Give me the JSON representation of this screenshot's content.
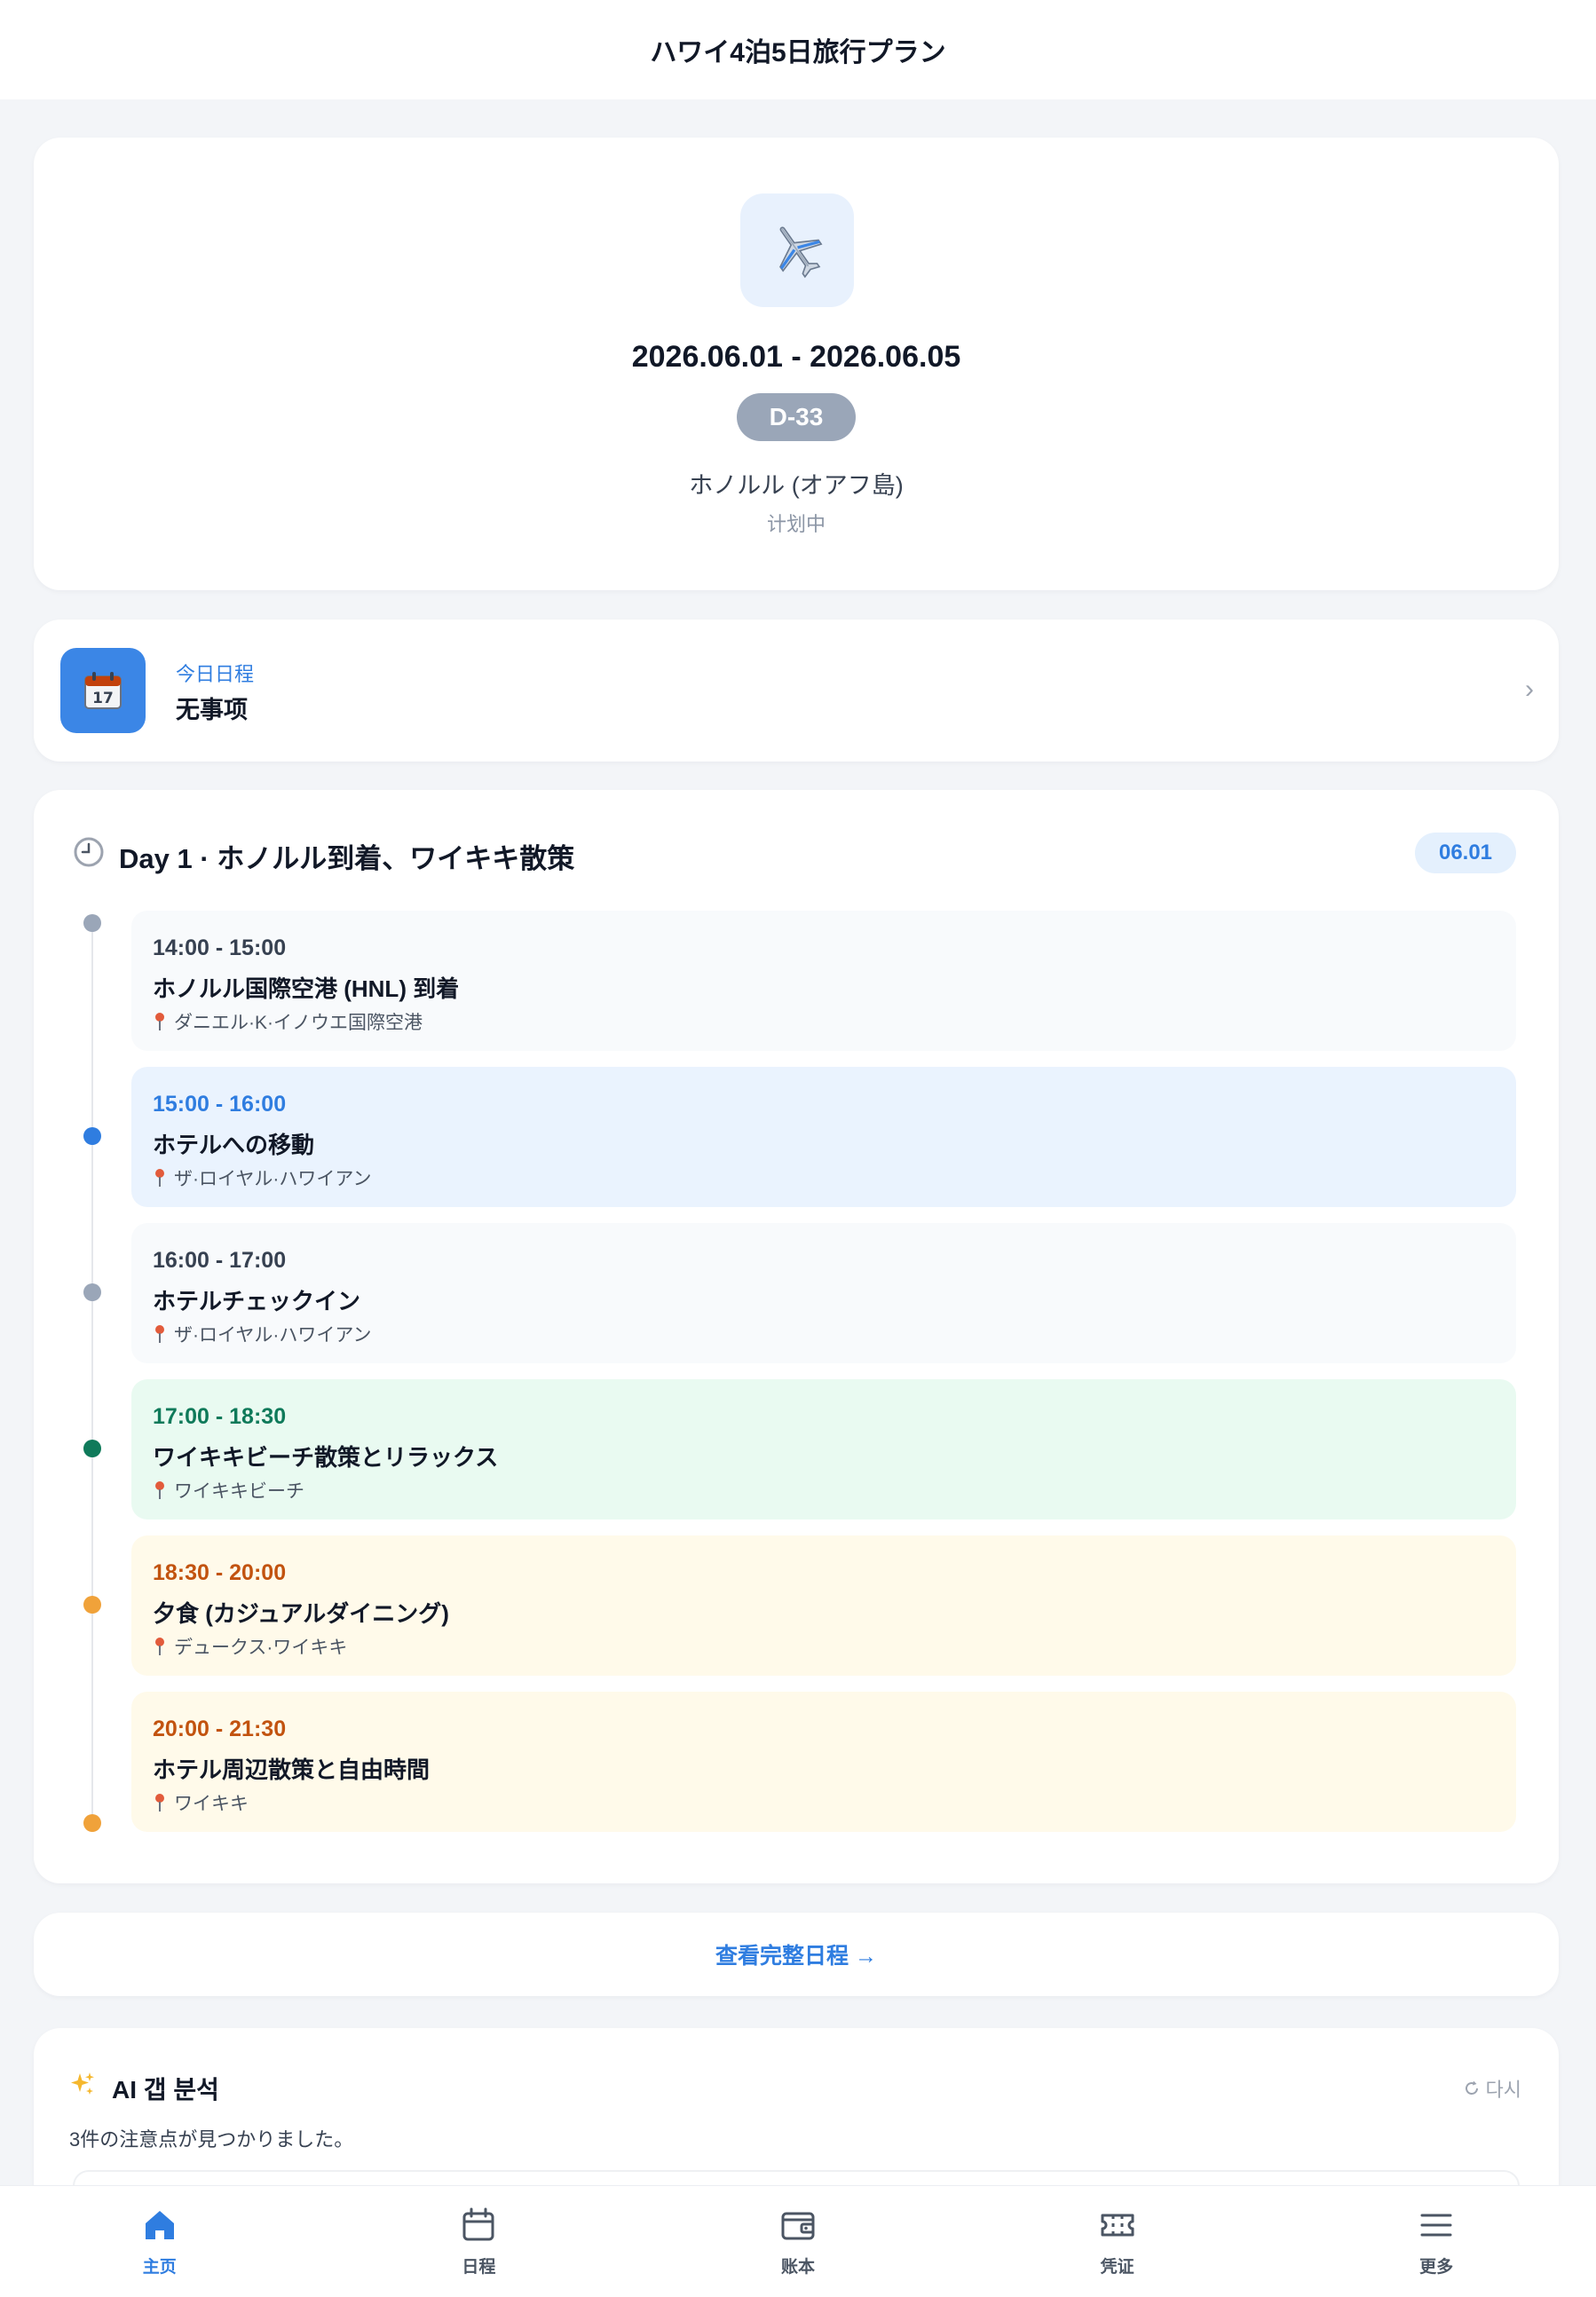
{
  "app": {
    "title": "ハワイ4泊5日旅行プラン"
  },
  "hero": {
    "icon": "airplane-icon",
    "dates": "2026.06.01 - 2026.06.05",
    "countdown": "D-33",
    "destination": "ホノルル (オアフ島)",
    "status": "计划中"
  },
  "today": {
    "icon": "calendar-icon",
    "label": "今日日程",
    "value": "无事项",
    "chevron": "›"
  },
  "day": {
    "title": "Day 1 · ホノルル到着、ワイキキ散策",
    "date": "06.01",
    "events": [
      {
        "time": "14:00 - 15:00",
        "title": "ホノルル国際空港 (HNL) 到着",
        "place": "ダニエル·K·イノウエ国際空港",
        "bg": "#f8fafc",
        "time_color": "#374151",
        "dot": "#9aa6b8"
      },
      {
        "time": "15:00 - 16:00",
        "title": "ホテルへの移動",
        "place": "ザ·ロイヤル·ハワイアン",
        "bg": "#eaf3fe",
        "time_color": "#2f7de0",
        "dot": "#2f7de0"
      },
      {
        "time": "16:00 - 17:00",
        "title": "ホテルチェックイン",
        "place": "ザ·ロイヤル·ハワイアン",
        "bg": "#f8fafc",
        "time_color": "#374151",
        "dot": "#9aa6b8"
      },
      {
        "time": "17:00 - 18:30",
        "title": "ワイキキビーチ散策とリラックス",
        "place": "ワイキキビーチ",
        "bg": "#e9faf1",
        "time_color": "#0f7a5a",
        "dot": "#0f7a5a"
      },
      {
        "time": "18:30 - 20:00",
        "title": "夕食 (カジュアルダイニング)",
        "place": "デュークス·ワイキキ",
        "bg": "#fffaea",
        "time_color": "#c2530f",
        "dot": "#f0a23a"
      },
      {
        "time": "20:00 - 21:30",
        "title": "ホテル周辺散策と自由時間",
        "place": "ワイキキ",
        "bg": "#fffaea",
        "time_color": "#c2530f",
        "dot": "#f0a23a"
      }
    ]
  },
  "view_full": {
    "label": "查看完整日程 →"
  },
  "ai": {
    "icon": "sparkles-icon",
    "title": "AI 갭 분석",
    "retry": "다시",
    "desc": "3件の注意点が見つかりました。"
  },
  "nav": [
    {
      "label": "主页",
      "icon": "home-icon",
      "active": true
    },
    {
      "label": "日程",
      "icon": "calendar-icon",
      "active": false
    },
    {
      "label": "账本",
      "icon": "wallet-icon",
      "active": false
    },
    {
      "label": "凭证",
      "icon": "ticket-icon",
      "active": false
    },
    {
      "label": "更多",
      "icon": "menu-icon",
      "active": false
    }
  ],
  "colors": {
    "accent": "#2f7de0",
    "background": "#f3f5f8",
    "badge": "#9aa6b8"
  }
}
